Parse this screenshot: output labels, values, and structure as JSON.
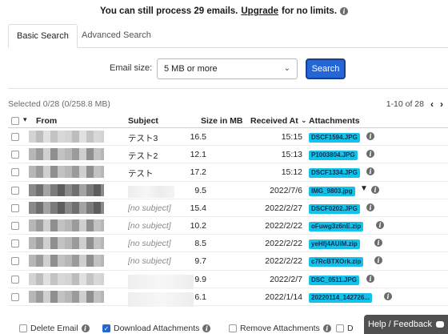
{
  "banner": {
    "text_before": "You can still process 29 emails.",
    "link": "Upgrade",
    "text_after": "for no limits."
  },
  "tabs": {
    "basic": "Basic Search",
    "advanced": "Advanced Search"
  },
  "filter": {
    "label": "Email size:",
    "value": "5 MB or more",
    "button": "Search"
  },
  "selection": {
    "text": "Selected 0/28 (0/258.8 MB)"
  },
  "pagination": {
    "range": "1-10 of 28",
    "prev": "‹",
    "next": "›"
  },
  "columns": {
    "from": "From",
    "subject": "Subject",
    "size": "Size in MB",
    "received": "Received At",
    "attachments": "Attachments"
  },
  "rows": [
    {
      "subject": "テスト3",
      "size": "16.5",
      "received": "15:15",
      "attachment": "DSCF1594.JPG"
    },
    {
      "subject": "テスト2",
      "size": "12.1",
      "received": "15:13",
      "attachment": "P1003804.JPG"
    },
    {
      "subject": "テスト",
      "size": "17.2",
      "received": "15:12",
      "attachment": "DSCF1334.JPG"
    },
    {
      "subject": "",
      "size": "9.5",
      "received": "2022/7/6",
      "attachment": "IMG_9803.jpg"
    },
    {
      "subject": "[no subject]",
      "size": "15.4",
      "received": "2022/2/27",
      "attachment": "DSCF0202.JPG"
    },
    {
      "subject": "[no subject]",
      "size": "10.2",
      "received": "2022/2/22",
      "attachment": "oFuwg3z6nE.zip"
    },
    {
      "subject": "[no subject]",
      "size": "8.5",
      "received": "2022/2/22",
      "attachment": "yeHfj4AUiM.zip"
    },
    {
      "subject": "[no subject]",
      "size": "9.7",
      "received": "2022/2/22",
      "attachment": "c7RcBTXOrk.zip"
    },
    {
      "subject": "",
      "size": "9.9",
      "received": "2022/2/7",
      "attachment": "DSC_0511.JPG"
    },
    {
      "subject": "",
      "size": "6.1",
      "received": "2022/1/14",
      "attachment": "20220114_142726..."
    }
  ],
  "footer": {
    "delete": "Delete Email",
    "download": "Download Attachments",
    "remove": "Remove Attachments",
    "d": "D"
  },
  "feedback": {
    "label": "Help / Feedback"
  },
  "colors": {
    "primary": "#2466d6",
    "badge": "#12c2e9",
    "feedback_bg": "#505050"
  }
}
